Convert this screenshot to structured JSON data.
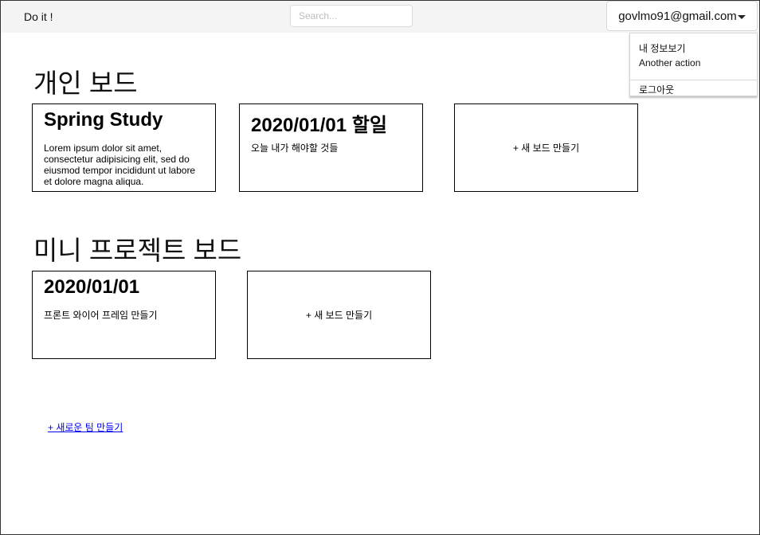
{
  "header": {
    "brand": "Do it !",
    "search_placeholder": "Search...",
    "user_email": "govlmo91@gmail.com"
  },
  "user_menu": {
    "items": [
      "내 정보보기",
      "Another action"
    ],
    "logout": "로그아웃"
  },
  "personal_boards": {
    "title": "개인 보드",
    "cards": [
      {
        "title": "Spring Study",
        "body": "Lorem ipsum dolor sit amet, consectetur adipisicing elit, sed do eiusmod tempor incididunt ut labore et dolore magna aliqua."
      },
      {
        "title": "2020/01/01 할일",
        "body": "오늘 내가 해야할 것들"
      }
    ],
    "new_board": "+ 새 보드 만들기"
  },
  "mini_project_boards": {
    "title": "미니 프로젝트 보드",
    "cards": [
      {
        "title": "2020/01/01",
        "body": "프론트 와이어 프레임 만들기"
      }
    ],
    "new_board": "+ 새 보드 만들기"
  },
  "new_team_link": "+ 새로운 팀 만들기"
}
